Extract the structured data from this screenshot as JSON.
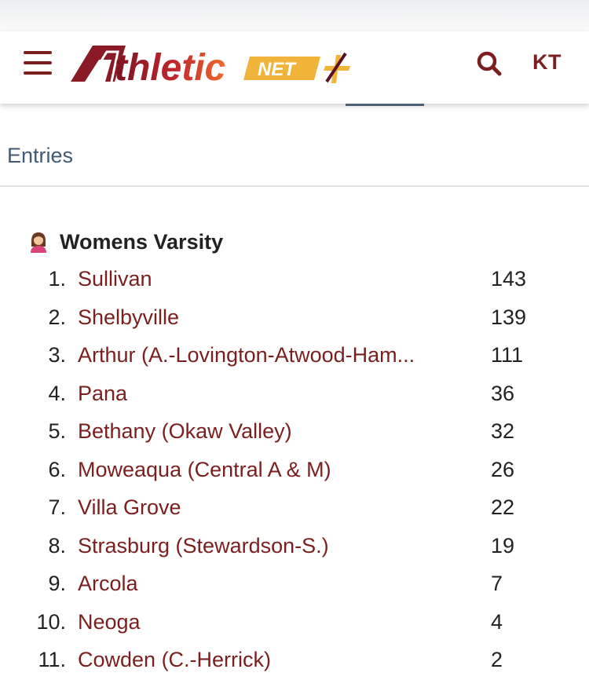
{
  "header": {
    "logo_main": "thletic",
    "logo_net": "NET",
    "user_initials": "KT"
  },
  "tabs": {
    "active_label": "Entries"
  },
  "section": {
    "title": "Womens Varsity"
  },
  "standings": [
    {
      "rank": "1.",
      "team": "Sullivan",
      "score": "143"
    },
    {
      "rank": "2.",
      "team": "Shelbyville",
      "score": "139"
    },
    {
      "rank": "3.",
      "team": "Arthur (A.-Lovington-Atwood-Ham...",
      "score": "111"
    },
    {
      "rank": "4.",
      "team": "Pana",
      "score": "36"
    },
    {
      "rank": "5.",
      "team": "Bethany (Okaw Valley)",
      "score": "32"
    },
    {
      "rank": "6.",
      "team": "Moweaqua (Central A & M)",
      "score": "26"
    },
    {
      "rank": "7.",
      "team": "Villa Grove",
      "score": "22"
    },
    {
      "rank": "8.",
      "team": "Strasburg (Stewardson-S.)",
      "score": "19"
    },
    {
      "rank": "9.",
      "team": "Arcola",
      "score": "7"
    },
    {
      "rank": "10.",
      "team": "Neoga",
      "score": "4"
    },
    {
      "rank": "11.",
      "team": "Cowden (C.-Herrick)",
      "score": "2"
    }
  ],
  "colors": {
    "brand": "#7b1e1e",
    "accent_gold": "#f0b43a",
    "link_muted": "#3f5b73"
  },
  "icons": {
    "menu": "hamburger-menu-icon",
    "search": "search-icon",
    "section": "woman-emoji-icon"
  }
}
